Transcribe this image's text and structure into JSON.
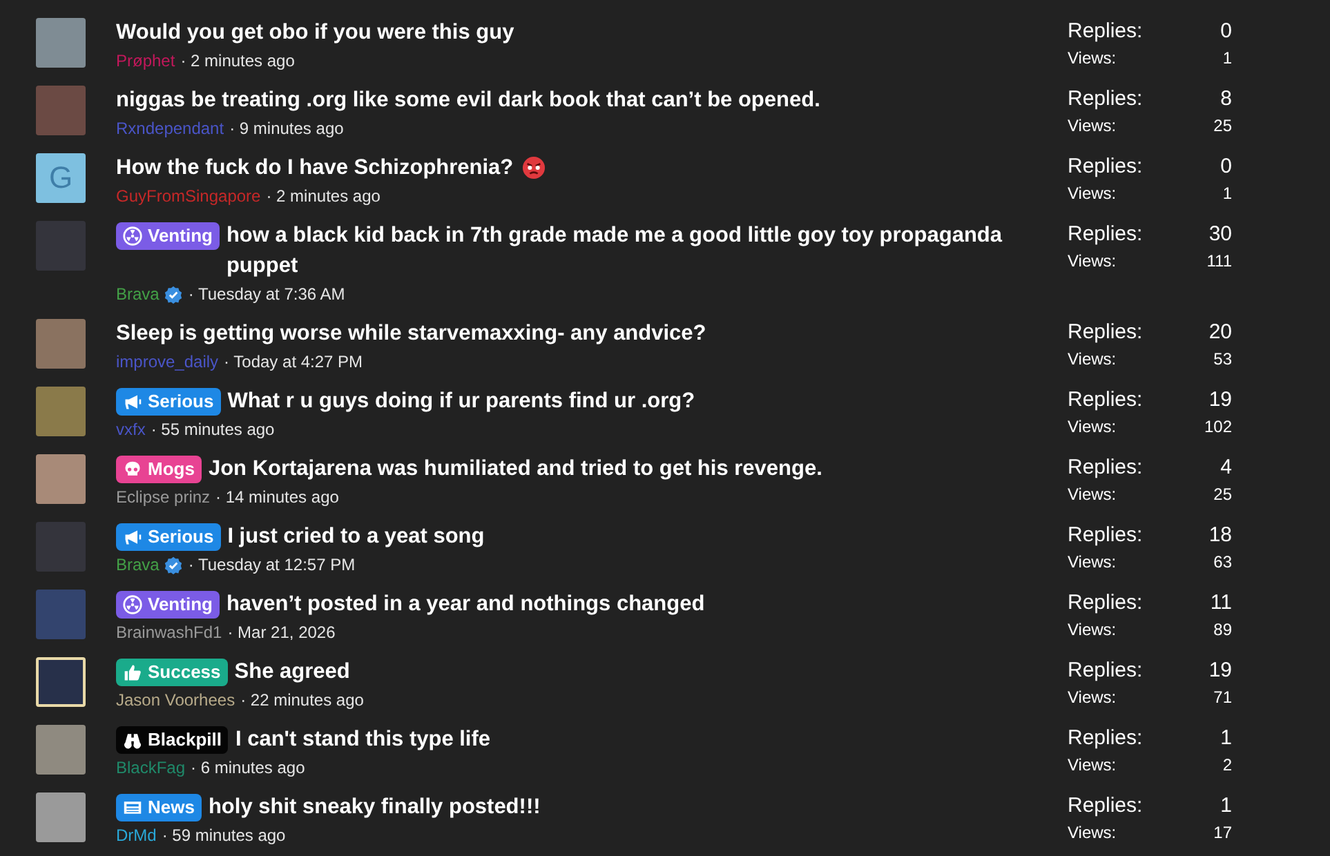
{
  "threads": [
    {
      "avatar": {
        "kind": "photo",
        "color": "#7f8c94"
      },
      "title": "Would you get obo if you were this guy",
      "angry_icon": false,
      "author": {
        "name": "Prøphet",
        "color": "#c2185b"
      },
      "verified": false,
      "time": "· 2 minutes ago",
      "replies_label": "Replies:",
      "replies": "0",
      "views_label": "Views:",
      "views": "1"
    },
    {
      "avatar": {
        "kind": "photo",
        "color": "#6b4a44"
      },
      "title": "niggas be treating .org like some evil dark book that can’t be opened.",
      "angry_icon": false,
      "author": {
        "name": "Rxndependant",
        "color": "#4a55c8"
      },
      "verified": false,
      "time": "· 9 minutes ago",
      "replies_label": "Replies:",
      "replies": "8",
      "views_label": "Views:",
      "views": "25"
    },
    {
      "avatar": {
        "kind": "letter",
        "color": "#7ec0e0",
        "letter": "G"
      },
      "title": "How the fuck do I have Schizophrenia?",
      "angry_icon": true,
      "author": {
        "name": "GuyFromSingapore",
        "color": "#c62828"
      },
      "verified": false,
      "time": "· 2 minutes ago",
      "replies_label": "Replies:",
      "replies": "0",
      "views_label": "Views:",
      "views": "1"
    },
    {
      "avatar": {
        "kind": "photo",
        "color": "#34343c"
      },
      "prefix": {
        "kind": "venting",
        "label": "Venting",
        "color": "#7b5ce6"
      },
      "title": "how a black kid back in 7th grade made me a good little goy toy propaganda puppet",
      "angry_icon": false,
      "author": {
        "name": "Brava",
        "color": "#43a047"
      },
      "verified": true,
      "time": "· Tuesday at 7:36 AM",
      "replies_label": "Replies:",
      "replies": "30",
      "views_label": "Views:",
      "views": "111"
    },
    {
      "avatar": {
        "kind": "photo",
        "color": "#8a7260"
      },
      "title": "Sleep is getting worse while starvemaxxing- any andvice?",
      "angry_icon": false,
      "author": {
        "name": "improve_daily",
        "color": "#4a55c8"
      },
      "verified": false,
      "time": "· Today at 4:27 PM",
      "replies_label": "Replies:",
      "replies": "20",
      "views_label": "Views:",
      "views": "53"
    },
    {
      "avatar": {
        "kind": "photo",
        "color": "#8a7a4a"
      },
      "prefix": {
        "kind": "serious",
        "label": "Serious",
        "color": "#1e88e5"
      },
      "title": "What r u guys doing if ur parents find ur .org?",
      "angry_icon": false,
      "author": {
        "name": "vxfx",
        "color": "#4a55c8"
      },
      "verified": false,
      "time": "· 55 minutes ago",
      "replies_label": "Replies:",
      "replies": "19",
      "views_label": "Views:",
      "views": "102"
    },
    {
      "avatar": {
        "kind": "photo",
        "color": "#a88a78"
      },
      "prefix": {
        "kind": "mogs",
        "label": "Mogs",
        "color": "#e84393"
      },
      "title": "Jon Kortajarena was humiliated and tried to get his revenge.",
      "angry_icon": false,
      "author": {
        "name": "Eclipse prinz",
        "color": "#9a9a9a"
      },
      "verified": false,
      "time": "· 14 minutes ago",
      "replies_label": "Replies:",
      "replies": "4",
      "views_label": "Views:",
      "views": "25"
    },
    {
      "avatar": {
        "kind": "photo",
        "color": "#34343c"
      },
      "prefix": {
        "kind": "serious",
        "label": "Serious",
        "color": "#1e88e5"
      },
      "title": "I just cried to a yeat song",
      "angry_icon": false,
      "author": {
        "name": "Brava",
        "color": "#43a047"
      },
      "verified": true,
      "time": "· Tuesday at 12:57 PM",
      "replies_label": "Replies:",
      "replies": "18",
      "views_label": "Views:",
      "views": "63"
    },
    {
      "avatar": {
        "kind": "photo",
        "color": "#33446e"
      },
      "prefix": {
        "kind": "venting",
        "label": "Venting",
        "color": "#7b5ce6"
      },
      "title": "haven’t posted in a year and nothings changed",
      "angry_icon": false,
      "author": {
        "name": "BrainwashFd1",
        "color": "#9a9a9a"
      },
      "verified": false,
      "time": "· Mar 21, 2026",
      "replies_label": "Replies:",
      "replies": "11",
      "views_label": "Views:",
      "views": "89"
    },
    {
      "avatar": {
        "kind": "framed",
        "color": "#27304a"
      },
      "prefix": {
        "kind": "success",
        "label": "Success",
        "color": "#1aab8b"
      },
      "title": "She agreed",
      "angry_icon": false,
      "author": {
        "name": "Jason Voorhees",
        "color": "#b8ab8a"
      },
      "verified": false,
      "time": "· 22 minutes ago",
      "replies_label": "Replies:",
      "replies": "19",
      "views_label": "Views:",
      "views": "71"
    },
    {
      "avatar": {
        "kind": "photo",
        "color": "#8f8a80"
      },
      "prefix": {
        "kind": "blackpill",
        "label": "Blackpill",
        "color": "#050505"
      },
      "title": "I can't stand this type life",
      "angry_icon": false,
      "author": {
        "name": "BlackFag",
        "color": "#1f8a6a"
      },
      "verified": false,
      "time": "· 6 minutes ago",
      "replies_label": "Replies:",
      "replies": "1",
      "views_label": "Views:",
      "views": "2"
    },
    {
      "avatar": {
        "kind": "photo",
        "color": "#9a9a9a"
      },
      "prefix": {
        "kind": "news",
        "label": "News",
        "color": "#1e88e5"
      },
      "title": "holy shit sneaky finally posted!!!",
      "angry_icon": false,
      "author": {
        "name": "DrMd",
        "color": "#29a8d8"
      },
      "verified": false,
      "time": "· 59 minutes ago",
      "replies_label": "Replies:",
      "replies": "1",
      "views_label": "Views:",
      "views": "17"
    }
  ]
}
